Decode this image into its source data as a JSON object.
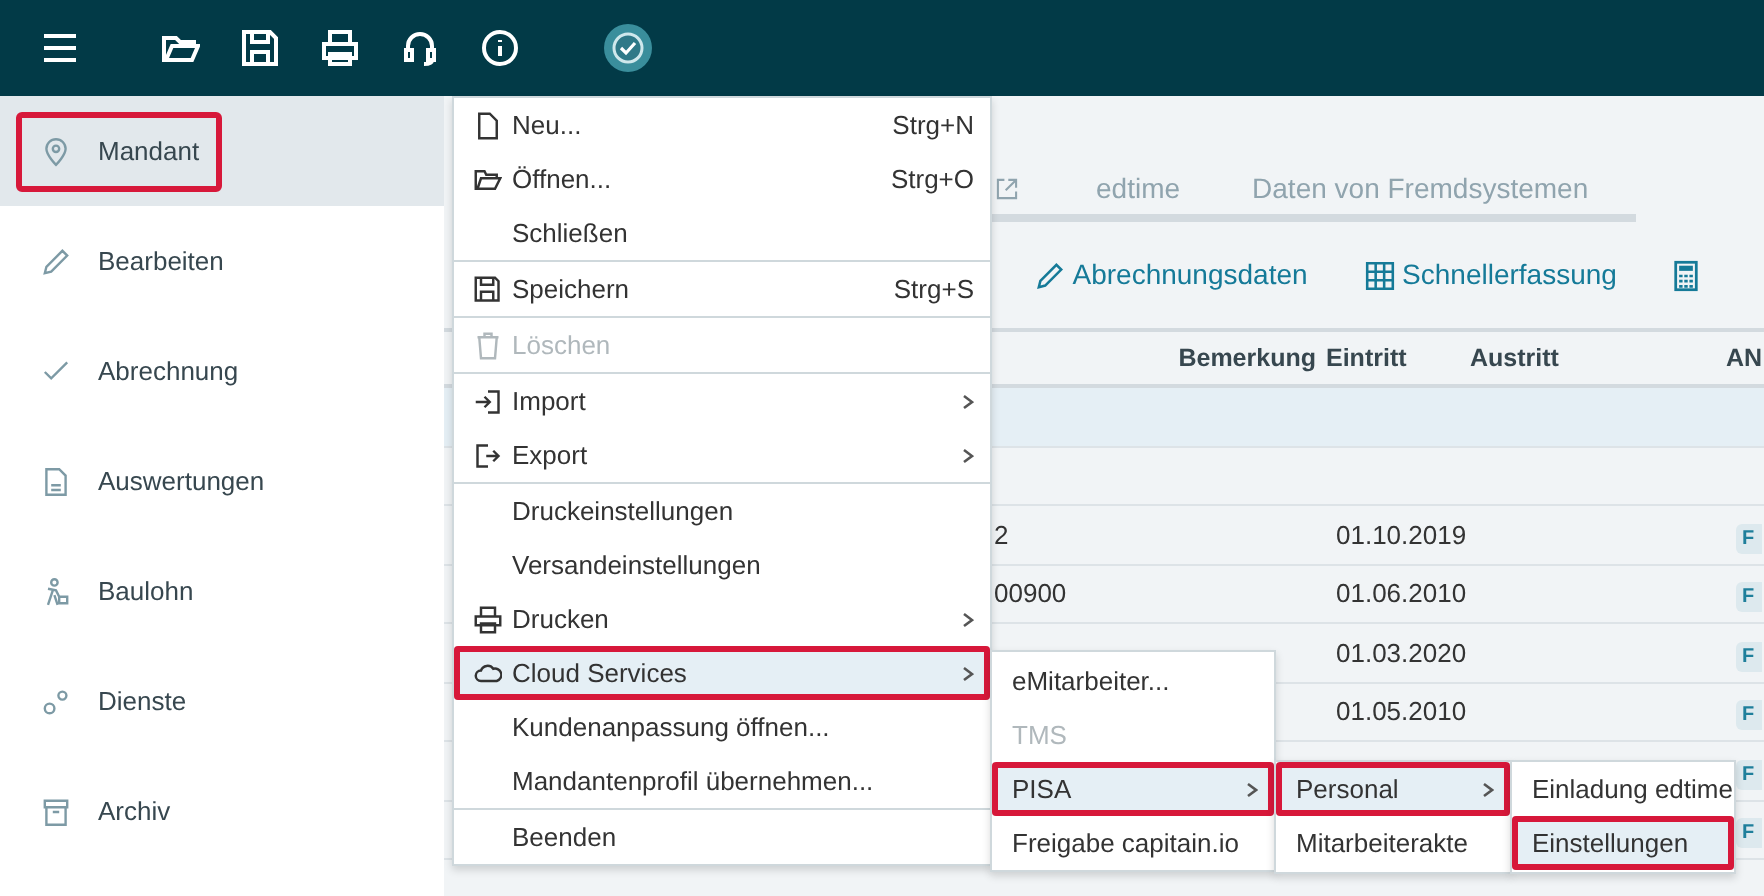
{
  "sidebar": {
    "items": [
      {
        "label": "Mandant",
        "selected": true,
        "outlined": true
      },
      {
        "label": "Bearbeiten",
        "selected": false,
        "outlined": false
      },
      {
        "label": "Abrechnung",
        "selected": false,
        "outlined": false
      },
      {
        "label": "Auswertungen",
        "selected": false,
        "outlined": false
      },
      {
        "label": "Baulohn",
        "selected": false,
        "outlined": false
      },
      {
        "label": "Dienste",
        "selected": false,
        "outlined": false
      },
      {
        "label": "Archiv",
        "selected": false,
        "outlined": false
      }
    ]
  },
  "tabs": [
    {
      "label": "edtime"
    },
    {
      "label": "Daten von Fremdsystemen"
    }
  ],
  "toolbar": [
    {
      "label": "Abrechnungsdaten"
    },
    {
      "label": "Schnellerfassung"
    }
  ],
  "table": {
    "columns": [
      "Bemerkung",
      "Eintritt",
      "Austritt",
      "AN"
    ],
    "rows": [
      {
        "selected": true
      },
      {
        "selected": false
      },
      {
        "selected": false,
        "column_1": "2",
        "eintritt": "01.10.2019",
        "an": "F"
      },
      {
        "selected": false,
        "column_1": "00900",
        "eintritt": "01.06.2010",
        "an": "F"
      },
      {
        "selected": false,
        "eintritt": "01.03.2020",
        "an": "F"
      },
      {
        "selected": false,
        "eintritt": "01.05.2010",
        "an": "F"
      },
      {
        "selected": false,
        "an": "F"
      },
      {
        "selected": false,
        "an": "F"
      }
    ]
  },
  "file_menu": {
    "groups": [
      [
        {
          "label": "Neu...",
          "shortcut": "Strg+N",
          "submenu": false,
          "disabled": false,
          "selected": false,
          "outlined": false
        },
        {
          "label": "Öffnen...",
          "shortcut": "Strg+O",
          "submenu": false,
          "disabled": false,
          "selected": false,
          "outlined": false
        },
        {
          "label": "Schließen",
          "submenu": false,
          "disabled": false,
          "selected": false,
          "outlined": false
        }
      ],
      [
        {
          "label": "Speichern",
          "shortcut": "Strg+S",
          "submenu": false,
          "disabled": false,
          "selected": false,
          "outlined": false
        }
      ],
      [
        {
          "label": "Löschen",
          "submenu": false,
          "disabled": true,
          "selected": false,
          "outlined": false
        }
      ],
      [
        {
          "label": "Import",
          "submenu": true,
          "disabled": false,
          "selected": false,
          "outlined": false
        },
        {
          "label": "Export",
          "submenu": true,
          "disabled": false,
          "selected": false,
          "outlined": false
        }
      ],
      [
        {
          "label": "Druckeinstellungen",
          "submenu": false,
          "disabled": false,
          "selected": false,
          "outlined": false
        },
        {
          "label": "Versandeinstellungen",
          "submenu": false,
          "disabled": false,
          "selected": false,
          "outlined": false
        },
        {
          "label": "Drucken",
          "submenu": true,
          "disabled": false,
          "selected": false,
          "outlined": false
        },
        {
          "label": "Cloud Services",
          "submenu": true,
          "disabled": false,
          "selected": true,
          "outlined": true
        },
        {
          "label": "Kundenanpassung öffnen...",
          "submenu": false,
          "disabled": false,
          "selected": false,
          "outlined": false
        },
        {
          "label": "Mandantenprofil übernehmen...",
          "submenu": false,
          "disabled": false,
          "selected": false,
          "outlined": false
        }
      ],
      [
        {
          "label": "Beenden",
          "submenu": false,
          "disabled": false,
          "selected": false,
          "outlined": false
        }
      ]
    ]
  },
  "submenus": [
    {
      "items": [
        {
          "label": "eMitarbeiter...",
          "submenu": false,
          "disabled": false,
          "selected": false,
          "outlined": false
        },
        {
          "label": "TMS",
          "submenu": false,
          "disabled": true,
          "selected": false,
          "outlined": false
        },
        {
          "label": "PISA",
          "submenu": true,
          "disabled": false,
          "selected": true,
          "outlined": true
        },
        {
          "label": "Freigabe capitain.io",
          "submenu": false,
          "disabled": false,
          "selected": false,
          "outlined": false
        }
      ]
    },
    {
      "items": [
        {
          "label": "Personal",
          "submenu": true,
          "disabled": false,
          "selected": true,
          "outlined": true
        },
        {
          "label": "Mitarbeiterakte",
          "submenu": false,
          "disabled": false,
          "selected": false,
          "outlined": false
        }
      ]
    },
    {
      "items": [
        {
          "label": "Einladung edtime",
          "submenu": false,
          "disabled": false,
          "selected": false,
          "outlined": false
        },
        {
          "label": "Einstellungen",
          "submenu": false,
          "disabled": false,
          "selected": true,
          "outlined": true
        }
      ]
    }
  ]
}
